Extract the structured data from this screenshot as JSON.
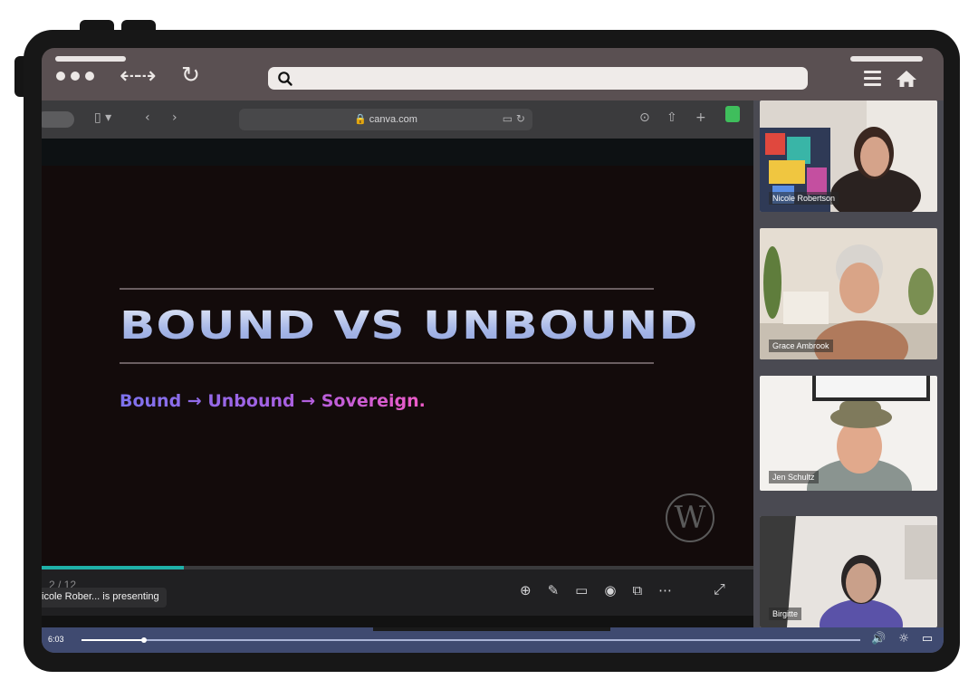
{
  "browser": {
    "search_value": "",
    "icons": [
      "window-dots-icon",
      "back-forward-icon",
      "reload-icon",
      "search-icon",
      "menu-icon",
      "home-icon"
    ]
  },
  "safari": {
    "url": "🔒 canva.com"
  },
  "slide": {
    "title": "BOUND VS UNBOUND",
    "subtitle": "Bound → Unbound → Sovereign.",
    "logo_letter": "W"
  },
  "presentation": {
    "page_indicator": "2 / 12",
    "presenting_label": "icole Rober... is presenting",
    "progress": 0.2
  },
  "participants": [
    {
      "name": "Nicole Robertson"
    },
    {
      "name": "Grace Ambrook"
    },
    {
      "name": "Jen Schultz"
    },
    {
      "name": "Birgitte"
    }
  ],
  "player": {
    "current_time": "6:03",
    "progress": 0.08
  },
  "colors": {
    "device_frame": "#171717",
    "chrome": "#5a5052",
    "slide_bg": "#130b0b",
    "progress_accent": "#1fb0a8",
    "player_bar": "#3f4a70"
  }
}
